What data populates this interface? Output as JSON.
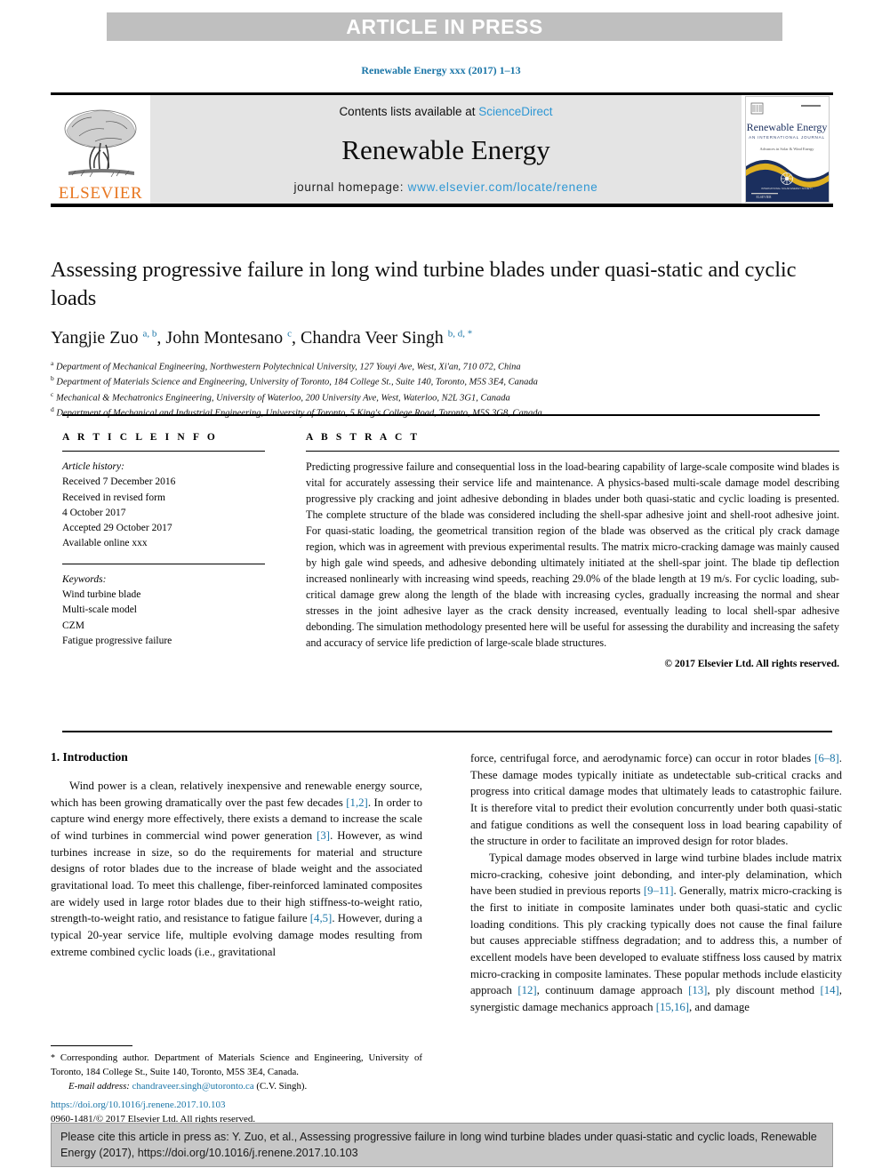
{
  "banner": {
    "text": "ARTICLE IN PRESS"
  },
  "running_head": "Renewable Energy xxx (2017) 1–13",
  "masthead": {
    "publisher": "ELSEVIER",
    "contents_prefix": "Contents lists available at ",
    "contents_link": "ScienceDirect",
    "journal_title": "Renewable Energy",
    "homepage_prefix": "journal homepage: ",
    "homepage_url": "www.elsevier.com/locate/renene",
    "cover_title": "Renewable Energy",
    "cover_subtitle": "AN INTERNATIONAL JOURNAL",
    "cover_tagline": "Advances in Solar & Wind Energy",
    "cover_footer": "ELSEVIER"
  },
  "article": {
    "title": "Assessing progressive failure in long wind turbine blades under quasi-static and cyclic loads",
    "authors_html": "Yangjie Zuo <sup>a, b</sup>, John Montesano <sup>c</sup>, Chandra Veer Singh <sup>b, d, *</sup>",
    "affiliations": [
      "Department of Mechanical Engineering, Northwestern Polytechnical University, 127 Youyi Ave, West, Xi'an, 710 072, China",
      "Department of Materials Science and Engineering, University of Toronto, 184 College St., Suite 140, Toronto, M5S 3E4, Canada",
      "Mechanical & Mechatronics Engineering, University of Waterloo, 200 University Ave, West, Waterloo, N2L 3G1, Canada",
      "Department of Mechanical and Industrial Engineering, University of Toronto, 5 King's College Road, Toronto, M5S 3G8, Canada"
    ],
    "affiliation_marks": [
      "a",
      "b",
      "c",
      "d"
    ]
  },
  "article_info": {
    "heading": "A R T I C L E   I N F O",
    "history_label": "Article history:",
    "history_lines": [
      "Received 7 December 2016",
      "Received in revised form",
      "4 October 2017",
      "Accepted 29 October 2017",
      "Available online xxx"
    ],
    "keywords_label": "Keywords:",
    "keywords": [
      "Wind turbine blade",
      "Multi-scale model",
      "CZM",
      "Fatigue progressive failure"
    ]
  },
  "abstract": {
    "heading": "A B S T R A C T",
    "text": "Predicting progressive failure and consequential loss in the load-bearing capability of large-scale composite wind blades is vital for accurately assessing their service life and maintenance. A physics-based multi-scale damage model describing progressive ply cracking and joint adhesive debonding in blades under both quasi-static and cyclic loading is presented. The complete structure of the blade was considered including the shell-spar adhesive joint and shell-root adhesive joint. For quasi-static loading, the geometrical transition region of the blade was observed as the critical ply crack damage region, which was in agreement with previous experimental results. The matrix micro-cracking damage was mainly caused by high gale wind speeds, and adhesive debonding ultimately initiated at the shell-spar joint. The blade tip deflection increased nonlinearly with increasing wind speeds, reaching 29.0% of the blade length at 19 m/s. For cyclic loading, sub-critical damage grew along the length of the blade with increasing cycles, gradually increasing the normal and shear stresses in the joint adhesive layer as the crack density increased, eventually leading to local shell-spar adhesive debonding. The simulation methodology presented here will be useful for assessing the durability and increasing the safety and accuracy of service life prediction of large-scale blade structures.",
    "copyright": "© 2017 Elsevier Ltd. All rights reserved."
  },
  "introduction": {
    "heading": "1. Introduction",
    "left_paragraph_html": "Wind power is a clean, relatively inexpensive and renewable energy source, which has been growing dramatically over the past few decades <span class=\"ref\">[1,2]</span>. In order to capture wind energy more effectively, there exists a demand to increase the scale of wind turbines in commercial wind power generation <span class=\"ref\">[3]</span>. However, as wind turbines increase in size, so do the requirements for material and structure designs of rotor blades due to the increase of blade weight and the associated gravitational load. To meet this challenge, fiber-reinforced laminated composites are widely used in large rotor blades due to their high stiffness-to-weight ratio, strength-to-weight ratio, and resistance to fatigue failure <span class=\"ref\">[4,5]</span>. However, during a typical 20-year service life, multiple evolving damage modes resulting from extreme combined cyclic loads (i.e., gravitational",
    "right_paragraph_1_html": "force, centrifugal force, and aerodynamic force) can occur in rotor blades <span class=\"ref\">[6–8]</span>. These damage modes typically initiate as undetectable sub-critical cracks and progress into critical damage modes that ultimately leads to catastrophic failure. It is therefore vital to predict their evolution concurrently under both quasi-static and fatigue conditions as well the consequent loss in load bearing capability of the structure in order to facilitate an improved design for rotor blades.",
    "right_paragraph_2_html": "Typical damage modes observed in large wind turbine blades include matrix micro-cracking, cohesive joint debonding, and inter-ply delamination, which have been studied in previous reports <span class=\"ref\">[9–11]</span>. Generally, matrix micro-cracking is the first to initiate in composite laminates under both quasi-static and cyclic loading conditions. This ply cracking typically does not cause the final failure but causes appreciable stiffness degradation; and to address this, a number of excellent models have been developed to evaluate stiffness loss caused by matrix micro-cracking in composite laminates. These popular methods include elasticity approach <span class=\"ref\">[12]</span>, continuum damage approach <span class=\"ref\">[13]</span>, ply discount method <span class=\"ref\">[14]</span>, synergistic damage mechanics approach <span class=\"ref\">[15,16]</span>, and damage"
  },
  "footnote": {
    "marker": "*",
    "text": "Corresponding author. Department of Materials Science and Engineering, University of Toronto, 184 College St., Suite 140, Toronto, M5S 3E4, Canada.",
    "email_label": "E-mail address:",
    "email": "chandraveer.singh@utoronto.ca",
    "email_suffix": "(C.V. Singh)."
  },
  "doi": {
    "link": "https://doi.org/10.1016/j.renene.2017.10.103",
    "issn_line": "0960-1481/© 2017 Elsevier Ltd. All rights reserved."
  },
  "cite_box": {
    "text": "Please cite this article in press as: Y. Zuo, et al., Assessing progressive failure in long wind turbine blades under quasi-static and cyclic loads, Renewable Energy (2017), https://doi.org/10.1016/j.renene.2017.10.103"
  },
  "colors": {
    "link_blue": "#1a75a7",
    "sd_blue": "#2e97d4",
    "elsevier_orange": "#e87722",
    "banner_gray": "#bfbfbf",
    "band_gray": "#e4e4e4",
    "cite_gray": "#c7c7c7"
  }
}
